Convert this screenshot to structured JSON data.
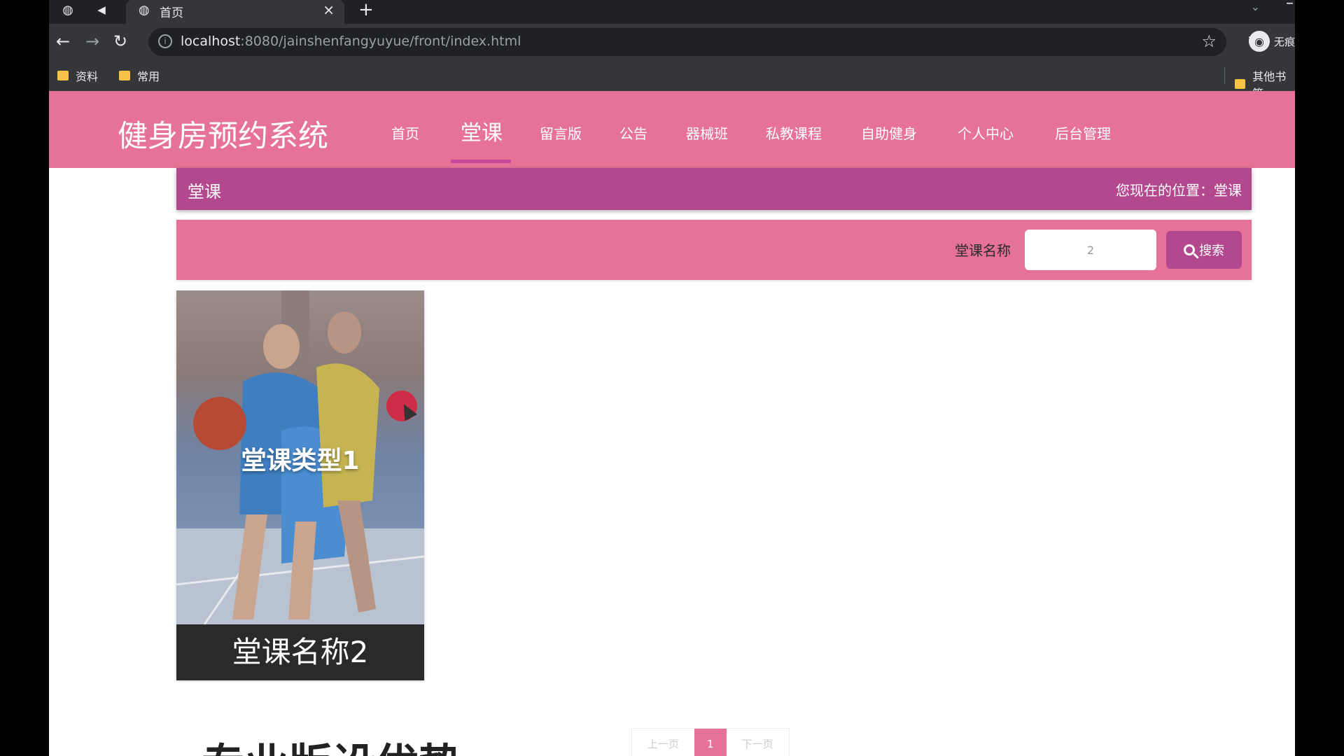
{
  "browser": {
    "tab_title": "首页",
    "url_host": "localhost",
    "url_rest": ":8080/jainshenfangyuyue/front/index.html",
    "profile_label": "无痕",
    "bookmarks": [
      "资料",
      "常用"
    ],
    "other_bookmarks": "其他书签"
  },
  "site": {
    "brand": "健身房预约系统",
    "nav": [
      "首页",
      "堂课",
      "留言版",
      "公告",
      "器械班",
      "私教课程",
      "自助健身",
      "个人中心",
      "后台管理"
    ],
    "active_nav": "堂课"
  },
  "breadcrumb": {
    "section": "堂课",
    "location_label": "您现在的位置：",
    "location_value": "堂课"
  },
  "search": {
    "label": "堂课名称",
    "value": "2",
    "button_label": "搜索"
  },
  "cards": [
    {
      "overlay": "堂课类型1",
      "name": "堂课名称2"
    }
  ],
  "pagination": {
    "prev": "上一页",
    "current": "1",
    "next": "下一页"
  },
  "section_title": "专业版设优势"
}
